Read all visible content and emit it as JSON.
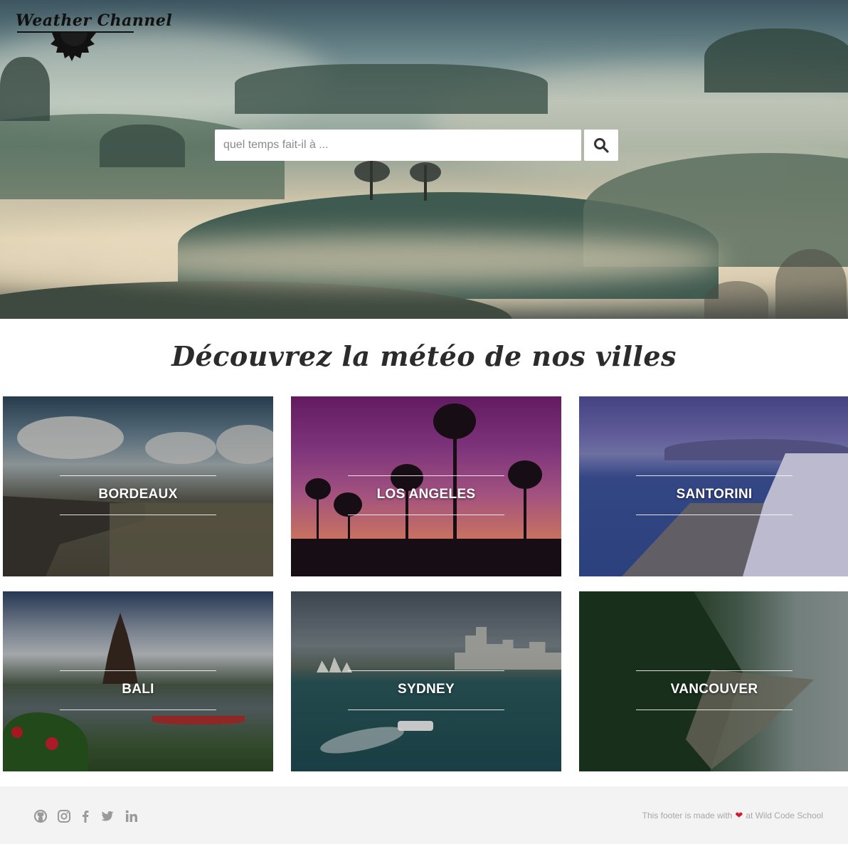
{
  "header": {
    "logo_text": "Weather Channel"
  },
  "search": {
    "placeholder": "quel temps fait-il à ...",
    "value": ""
  },
  "section": {
    "title": "Découvrez la météo de nos villes"
  },
  "cities": [
    {
      "name": "BORDEAUX"
    },
    {
      "name": "LOS ANGELES"
    },
    {
      "name": "SANTORINI"
    },
    {
      "name": "BALI"
    },
    {
      "name": "SYDNEY"
    },
    {
      "name": "VANCOUVER"
    }
  ],
  "footer": {
    "social_icons": [
      "github-icon",
      "instagram-icon",
      "facebook-icon",
      "twitter-icon",
      "linkedin-icon"
    ],
    "text_before": "This footer is made with",
    "text_after": "at Wild Code School"
  },
  "colors": {
    "footer_bg": "#f3f3f3",
    "heart": "#d01b2e",
    "icon_gray": "#9a9a9a"
  }
}
